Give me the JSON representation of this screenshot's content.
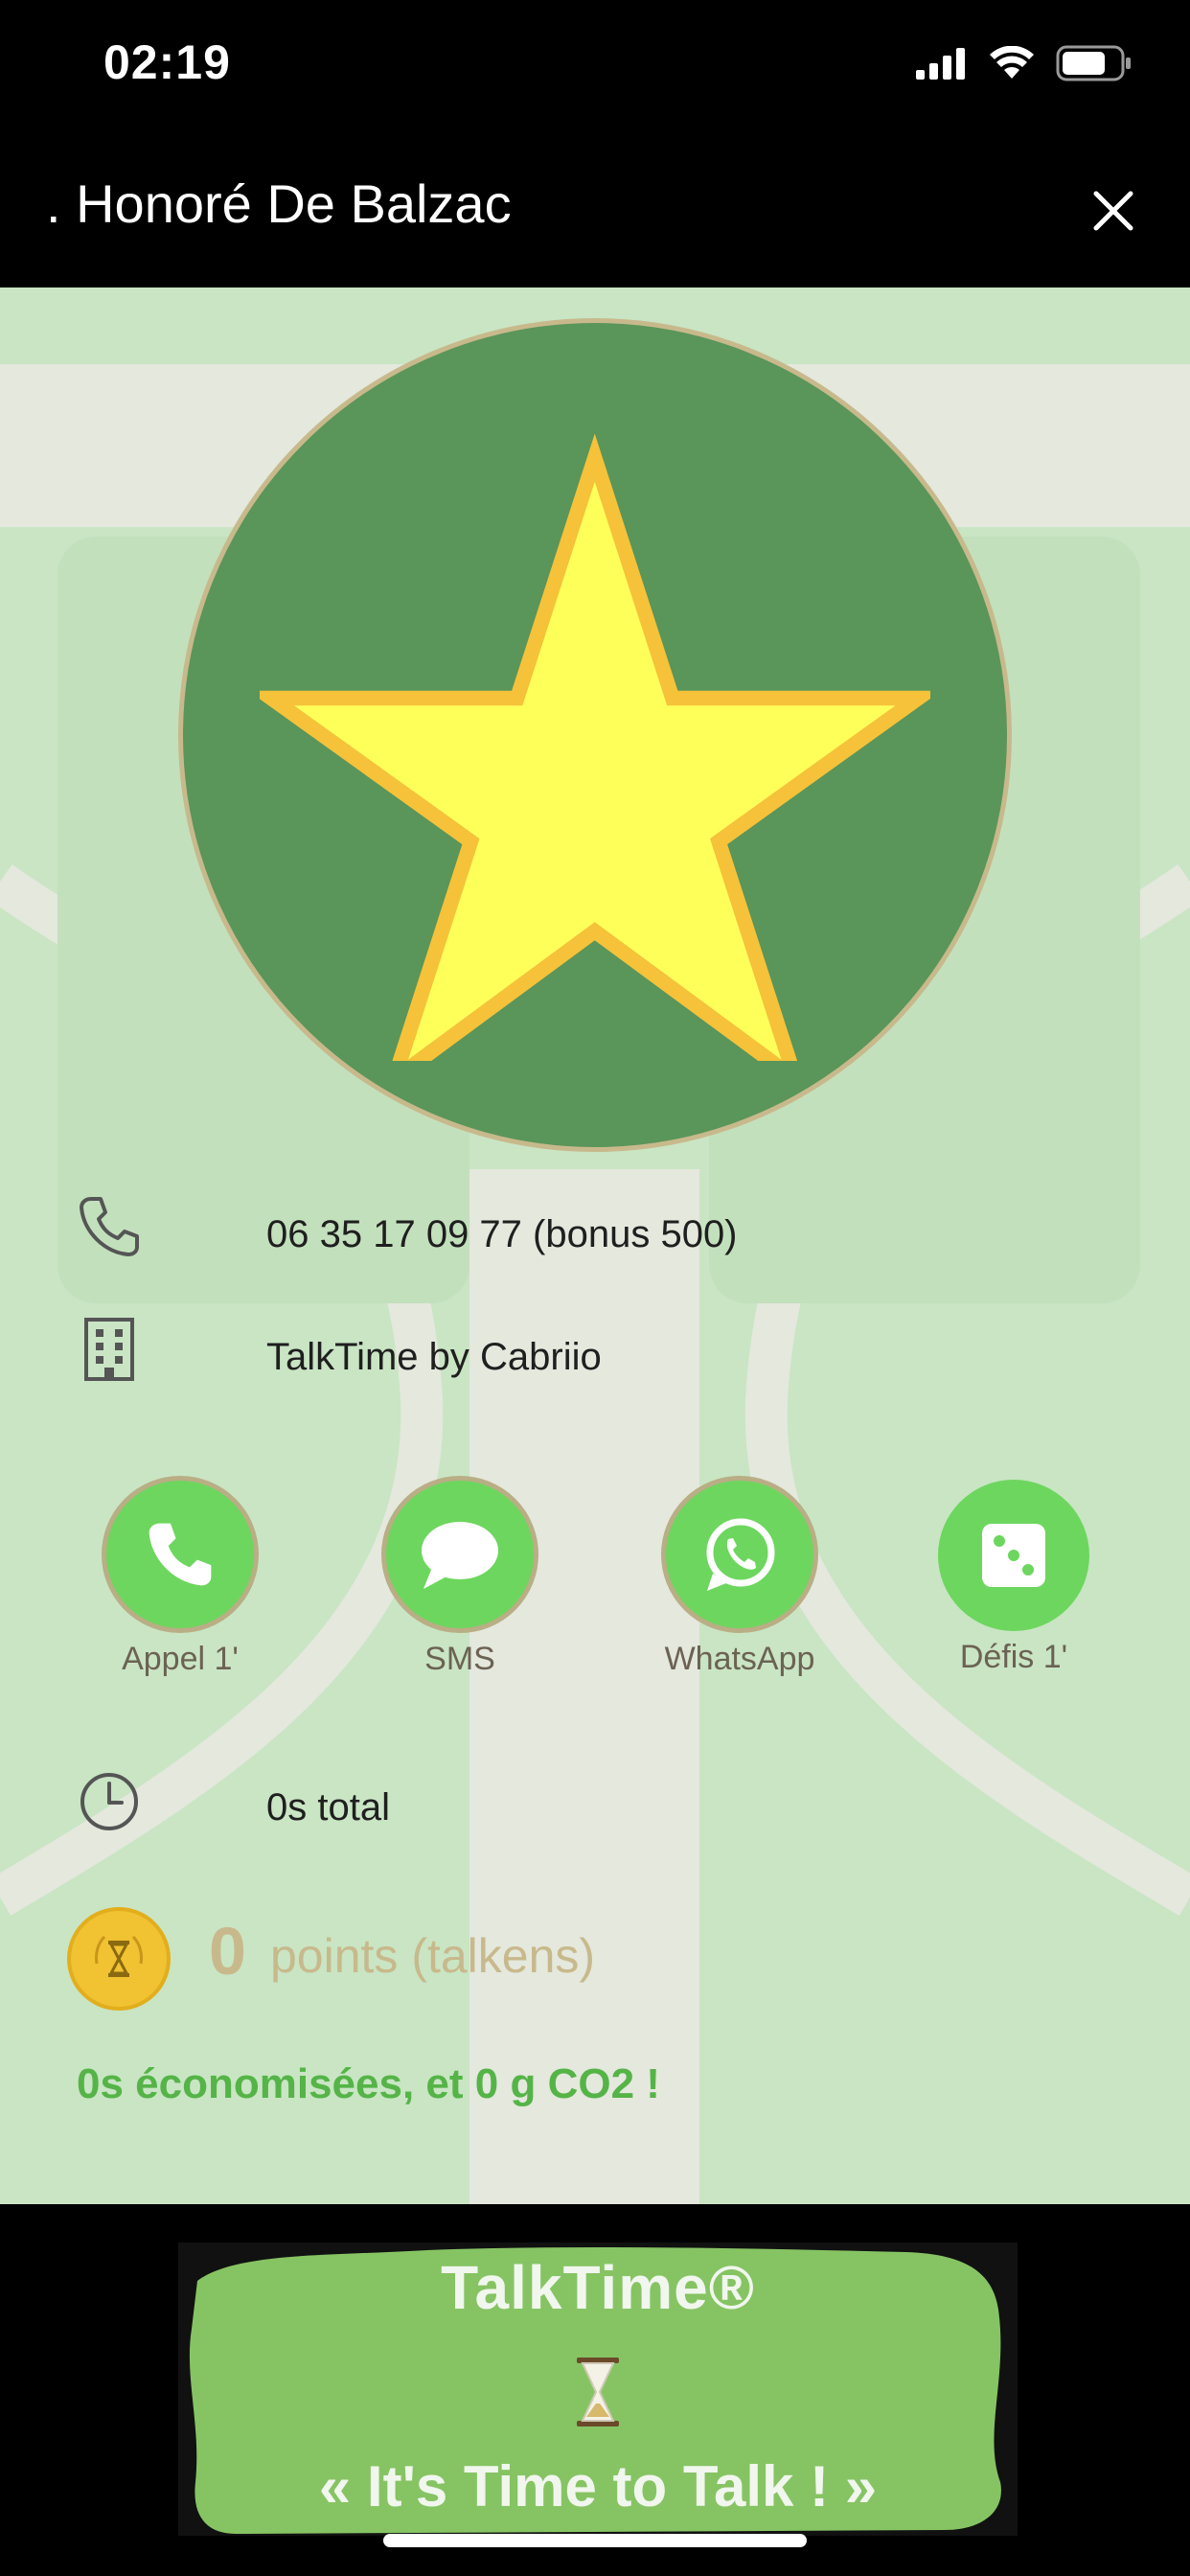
{
  "status_bar": {
    "time": "02:19"
  },
  "header": {
    "title": ". Honoré De Balzac",
    "close_icon": "close-icon"
  },
  "contact": {
    "phone": "06 35 17 09 77 (bonus 500)",
    "company": "TalkTime by Cabriio"
  },
  "actions": [
    {
      "label": "Appel 1'",
      "icon": "phone-icon"
    },
    {
      "label": "SMS",
      "icon": "chat-bubble-icon"
    },
    {
      "label": "WhatsApp",
      "icon": "whatsapp-icon"
    },
    {
      "label": "Défis 1'",
      "icon": "dice-icon"
    }
  ],
  "stats": {
    "total_time": "0s total",
    "points_value": "0",
    "points_label": "points (talkens)",
    "savings": "0s économisées, et 0 g CO2 !"
  },
  "banner": {
    "title": "TalkTime®",
    "slogan": "« It's Time to Talk  ! »"
  },
  "colors": {
    "background": "#c9e5c4",
    "avatar_fill": "#5a955a",
    "star_fill": "#ffff5a",
    "action_green": "#6dd65e",
    "accent_green": "#55b447",
    "muted_gold": "#c8b98c"
  }
}
